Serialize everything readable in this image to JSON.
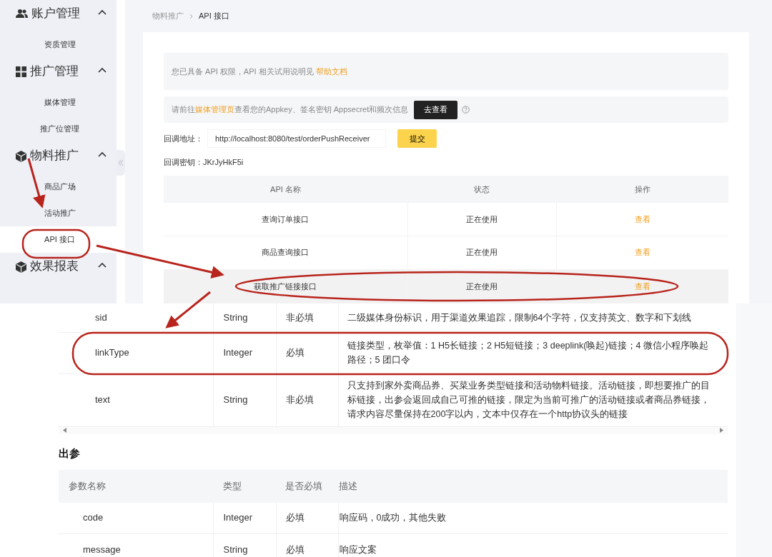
{
  "sidebar": {
    "groups": [
      {
        "title": "账户管理",
        "expanded": true,
        "items": [
          {
            "label": "资质管理",
            "selected": false
          }
        ]
      },
      {
        "title": "推广管理",
        "expanded": true,
        "items": [
          {
            "label": "媒体管理",
            "selected": false
          },
          {
            "label": "推广位管理",
            "selected": false
          }
        ]
      },
      {
        "title": "物料推广",
        "expanded": true,
        "items": [
          {
            "label": "商品广场",
            "selected": false
          },
          {
            "label": "活动推广",
            "selected": false
          },
          {
            "label": "API 接口",
            "selected": true
          }
        ]
      },
      {
        "title": "效果报表",
        "expanded": true
      }
    ]
  },
  "breadcrumb": [
    "物料推广",
    "API 接口"
  ],
  "notices": [
    {
      "kind": "help",
      "text": "您已具备 API 权限，API 相关试用说明见",
      "link": "帮助文档"
    },
    {
      "kind": "media",
      "prefix": "请前往",
      "link": "媒体管理页",
      "suffix": "查看您的Appkey、签名密钥 Appsecret和频次信息",
      "button": "去查看"
    }
  ],
  "callback": {
    "label": "回调地址：",
    "value": "http://localhost:8080/test/orderPushReceiver",
    "button": "提交"
  },
  "secret": "回调密钥：JKrJyHkF5i",
  "api_table": {
    "columns": [
      "API 名称",
      "状态",
      "操作"
    ],
    "rows": [
      {
        "name": "查询订单接口",
        "status": "正在使用",
        "action": "查看",
        "highlighted": false
      },
      {
        "name": "商品查询接口",
        "status": "正在使用",
        "action": "查看",
        "highlighted": false
      },
      {
        "name": "获取推广链接接口",
        "status": "正在使用",
        "action": "查看",
        "highlighted": true
      }
    ]
  },
  "input_params": {
    "rows": [
      {
        "name": "sid",
        "type": "String",
        "required": "非必填",
        "description": "二级媒体身份标识，用于渠道效果追踪，限制64个字符，仅支持英文、数字和下划线"
      },
      {
        "name": "linkType",
        "type": "Integer",
        "required": "必填",
        "description": "链接类型，枚举值：1 H5长链接；2 H5短链接；3 deeplink(唤起)链接；4 微信小程序唤起路径；5 团口令"
      },
      {
        "name": "text",
        "type": "String",
        "required": "非必填",
        "description": "只支持到家外卖商品券、买菜业务类型链接和活动物料链接。活动链接，即想要推广的目标链接，出参会返回成自己可推的链接，限定为当前可推广的活动链接或者商品券链接，请求内容尽量保持在200字以内，文本中仅存在一个http协议头的链接"
      }
    ]
  },
  "output_params": {
    "title": "出参",
    "columns": [
      "参数名称",
      "类型",
      "是否必填",
      "描述"
    ],
    "rows": [
      {
        "name": "code",
        "type": "Integer",
        "required": "必填",
        "description": "响应码，0成功，其他失败"
      },
      {
        "name": "message",
        "type": "String",
        "required": "必填",
        "description": "响应文案"
      }
    ]
  }
}
